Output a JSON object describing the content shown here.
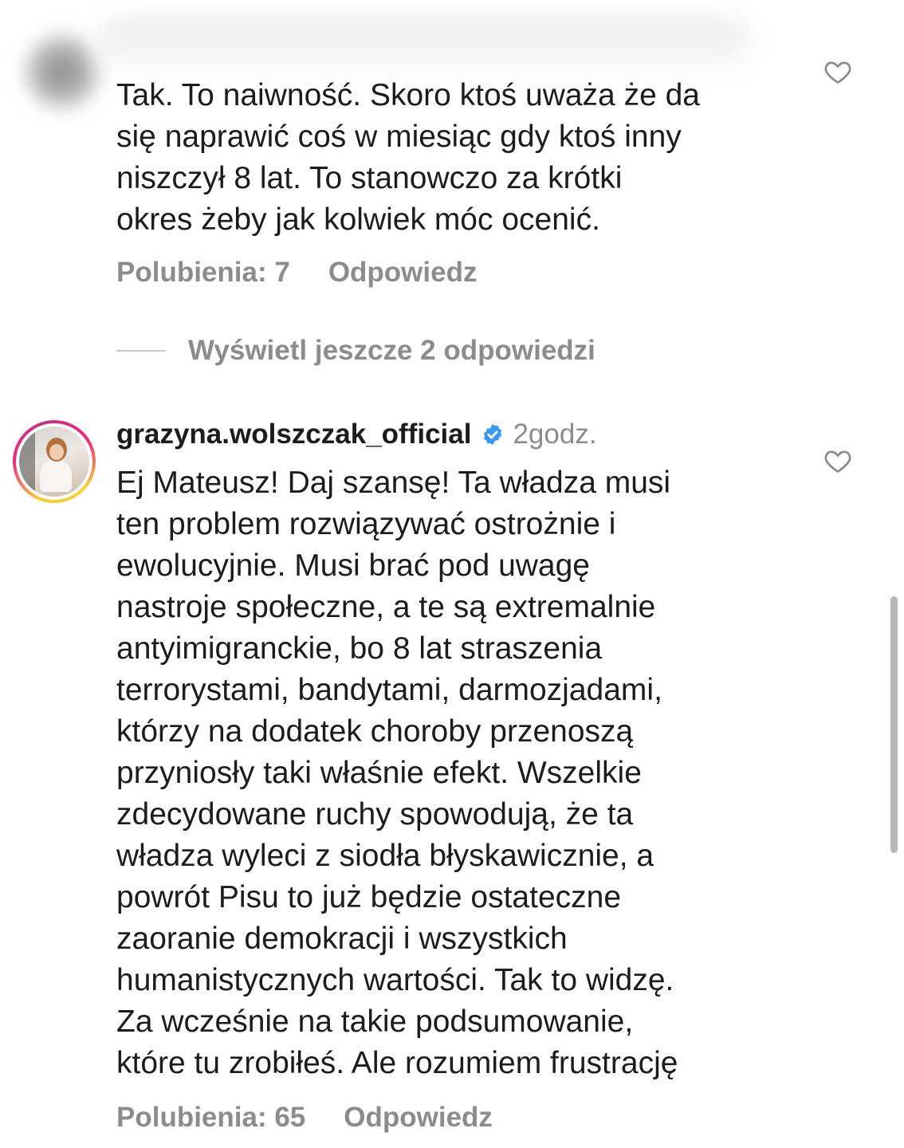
{
  "comment1": {
    "text": "Tak. To naiwność. Skoro ktoś uważa że da\nsię  naprawić coś w miesiąc gdy ktoś inny\nniszczył 8 lat. To stanowczo za krótki\nokres żeby jak kolwiek móc ocenić.",
    "likes": "Polubienia: 7",
    "reply": "Odpowiedz"
  },
  "view_replies": "Wyświetl jeszcze 2 odpowiedzi",
  "comment2": {
    "username": "grazyna.wolszczak_official",
    "time": "2godz.",
    "text": "Ej Mateusz! Daj szansę! Ta władza musi\nten problem rozwiązywać ostrożnie i\newolucyjnie. Musi brać pod uwagę\nnastroje społeczne, a te są extremalnie\nantyimigranckie, bo 8 lat straszenia\nterrorystami, bandytami, darmozjadami,\nktórzy na dodatek choroby przenoszą\nprzyniosły taki właśnie efekt. Wszelkie\nzdecydowane ruchy spowodują, że ta\nwładza wyleci z siodła błyskawicznie, a\npowrót Pisu to już będzie ostateczne\nzaoranie demokracji i wszystkich\nhumanistycznych wartości. Tak to widzę.\nZa wcześnie na takie podsumowanie,\nktóre tu zrobiłeś. Ale rozumiem frustrację",
    "likes": "Polubienia: 65",
    "reply": "Odpowiedz"
  },
  "icons": {
    "like": "heart-outline-icon",
    "verified": "verified-badge-icon"
  },
  "colors": {
    "verified": "#3897f0",
    "secondary_text": "#8c8c8c",
    "primary_text": "#1c1c1c"
  }
}
